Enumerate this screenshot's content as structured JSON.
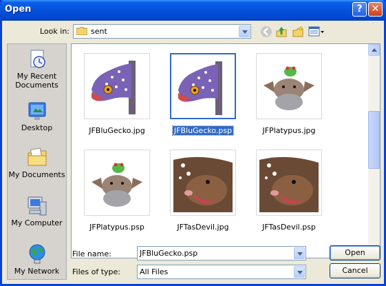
{
  "window": {
    "title": "Open"
  },
  "titlebar": {
    "help_glyph": "?",
    "close_glyph": "✕"
  },
  "lookin": {
    "label": "Look in:",
    "value": "sent"
  },
  "toolbar": {
    "icons": [
      "back-icon",
      "up-folder-icon",
      "new-folder-icon",
      "views-menu-icon"
    ]
  },
  "places": [
    {
      "label": "My Recent Documents",
      "icon": "recent-documents-icon"
    },
    {
      "label": "Desktop",
      "icon": "desktop-icon"
    },
    {
      "label": "My Documents",
      "icon": "my-documents-icon"
    },
    {
      "label": "My Computer",
      "icon": "my-computer-icon"
    },
    {
      "label": "My Network",
      "icon": "my-network-icon"
    }
  ],
  "files": [
    {
      "name": "JFBluGecko.jpg",
      "thumb": "gecko",
      "selected": false
    },
    {
      "name": "JFBluGecko.psp",
      "thumb": "gecko",
      "selected": true
    },
    {
      "name": "JFPlatypus.jpg",
      "thumb": "platypus",
      "selected": false
    },
    {
      "name": "JFPlatypus.psp",
      "thumb": "platypus",
      "selected": false
    },
    {
      "name": "JFTasDevil.jpg",
      "thumb": "tasdevil",
      "selected": false
    },
    {
      "name": "JFTasDevil.psp",
      "thumb": "tasdevil",
      "selected": false
    }
  ],
  "filename": {
    "label": "File name:",
    "value": "JFBluGecko.psp"
  },
  "filetype": {
    "label": "Files of type:",
    "value": "All Files"
  },
  "buttons": {
    "open": "Open",
    "cancel": "Cancel"
  },
  "colors": {
    "titlebar": "#0452dc",
    "selection": "#316ac5",
    "dialog_bg": "#ece9d8"
  }
}
